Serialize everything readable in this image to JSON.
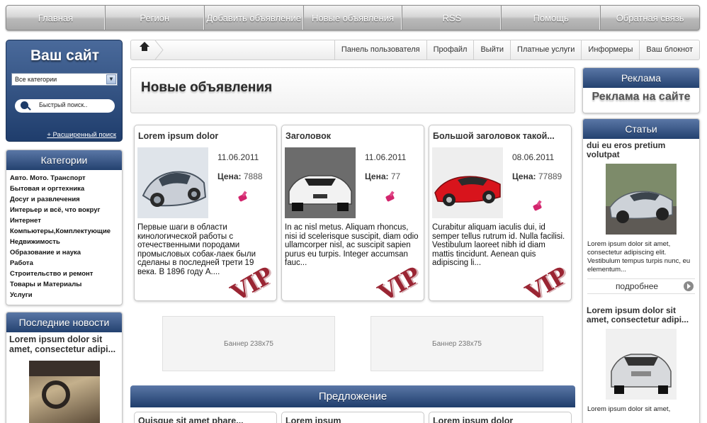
{
  "nav": {
    "items": [
      "Главная",
      "Регион",
      "Добавить объявление",
      "Новые объявления",
      "RSS",
      "Помощь",
      "Обратная связь"
    ]
  },
  "site": {
    "title": "Ваш сайт",
    "category_select": "Все категории",
    "quick_search": "Быстрый поиск..",
    "advanced_search": "+ Расширенный поиск"
  },
  "categories": {
    "title": "Категории",
    "items": [
      "Авто. Мото. Транспорт",
      "Бытовая и оргтехника",
      "Досуг и развлечения",
      "Интерьер и всё, что вокруг",
      "Интернет",
      "Компьютеры,Комплектующие",
      "Недвижимость",
      "Образование и наука",
      "Работа",
      "Строительство и ремонт",
      "Товары и Материалы",
      "Услуги"
    ]
  },
  "latest_news": {
    "title": "Последние новости",
    "item_title": "Lorem ipsum dolor sit amet, consectetur adipi..."
  },
  "breadcrumb": {
    "links": [
      "Панель пользователя",
      "Профайл",
      "Выйти",
      "Платные услуги",
      "Информеры",
      "Ваш блокнот"
    ]
  },
  "main": {
    "heading": "Новые объявления",
    "price_label": "Цена:",
    "vip_label": "VIP",
    "cards": [
      {
        "title": "Lorem ipsum dolor",
        "date": "11.06.2011",
        "price": "7888",
        "description": "Первые шаги в области кинологической работы с отечественными породами промысловых собак-лаек были сделаны в последней трети 19 века. В 1896 году А...."
      },
      {
        "title": "Заголовок",
        "date": "11.06.2011",
        "price": "77",
        "description": "In ac nisl metus. Aliquam rhoncus, nisi id scelerisque suscipit, diam odio ullamcorper nisl, ac suscipit sapien purus eu turpis. Integer accumsan fauc..."
      },
      {
        "title": "Большой заголовок такой...",
        "date": "08.06.2011",
        "price": "77889",
        "description": "Curabitur aliquam iaculis dui, id semper tellus rutrum id. Nulla facilisi. Vestibulum laoreet nibh id diam mattis tincidunt. Aenean quis adipiscing li..."
      }
    ],
    "banners": [
      "Баннер 238x75",
      "Баннер 238x75"
    ],
    "offer_title": "Предложение",
    "offer_items": [
      "Quisque sit amet phare...",
      "Lorem ipsum",
      "Lorem ipsum dolor"
    ]
  },
  "ads": {
    "title": "Реклама",
    "text": "Реклама на сайте"
  },
  "articles": {
    "title": "Статьи",
    "items": [
      {
        "title": "dui eu eros pretium volutpat",
        "description": "Lorem ipsum dolor sit amet, consectetur adipiscing elit. Vestibulum tempus turpis nunc, eu elementum...",
        "more": "подробнее"
      },
      {
        "title": "Lorem ipsum dolor sit amet, consectetur adipi...",
        "description": "Lorem ipsum dolor sit amet,"
      }
    ]
  }
}
